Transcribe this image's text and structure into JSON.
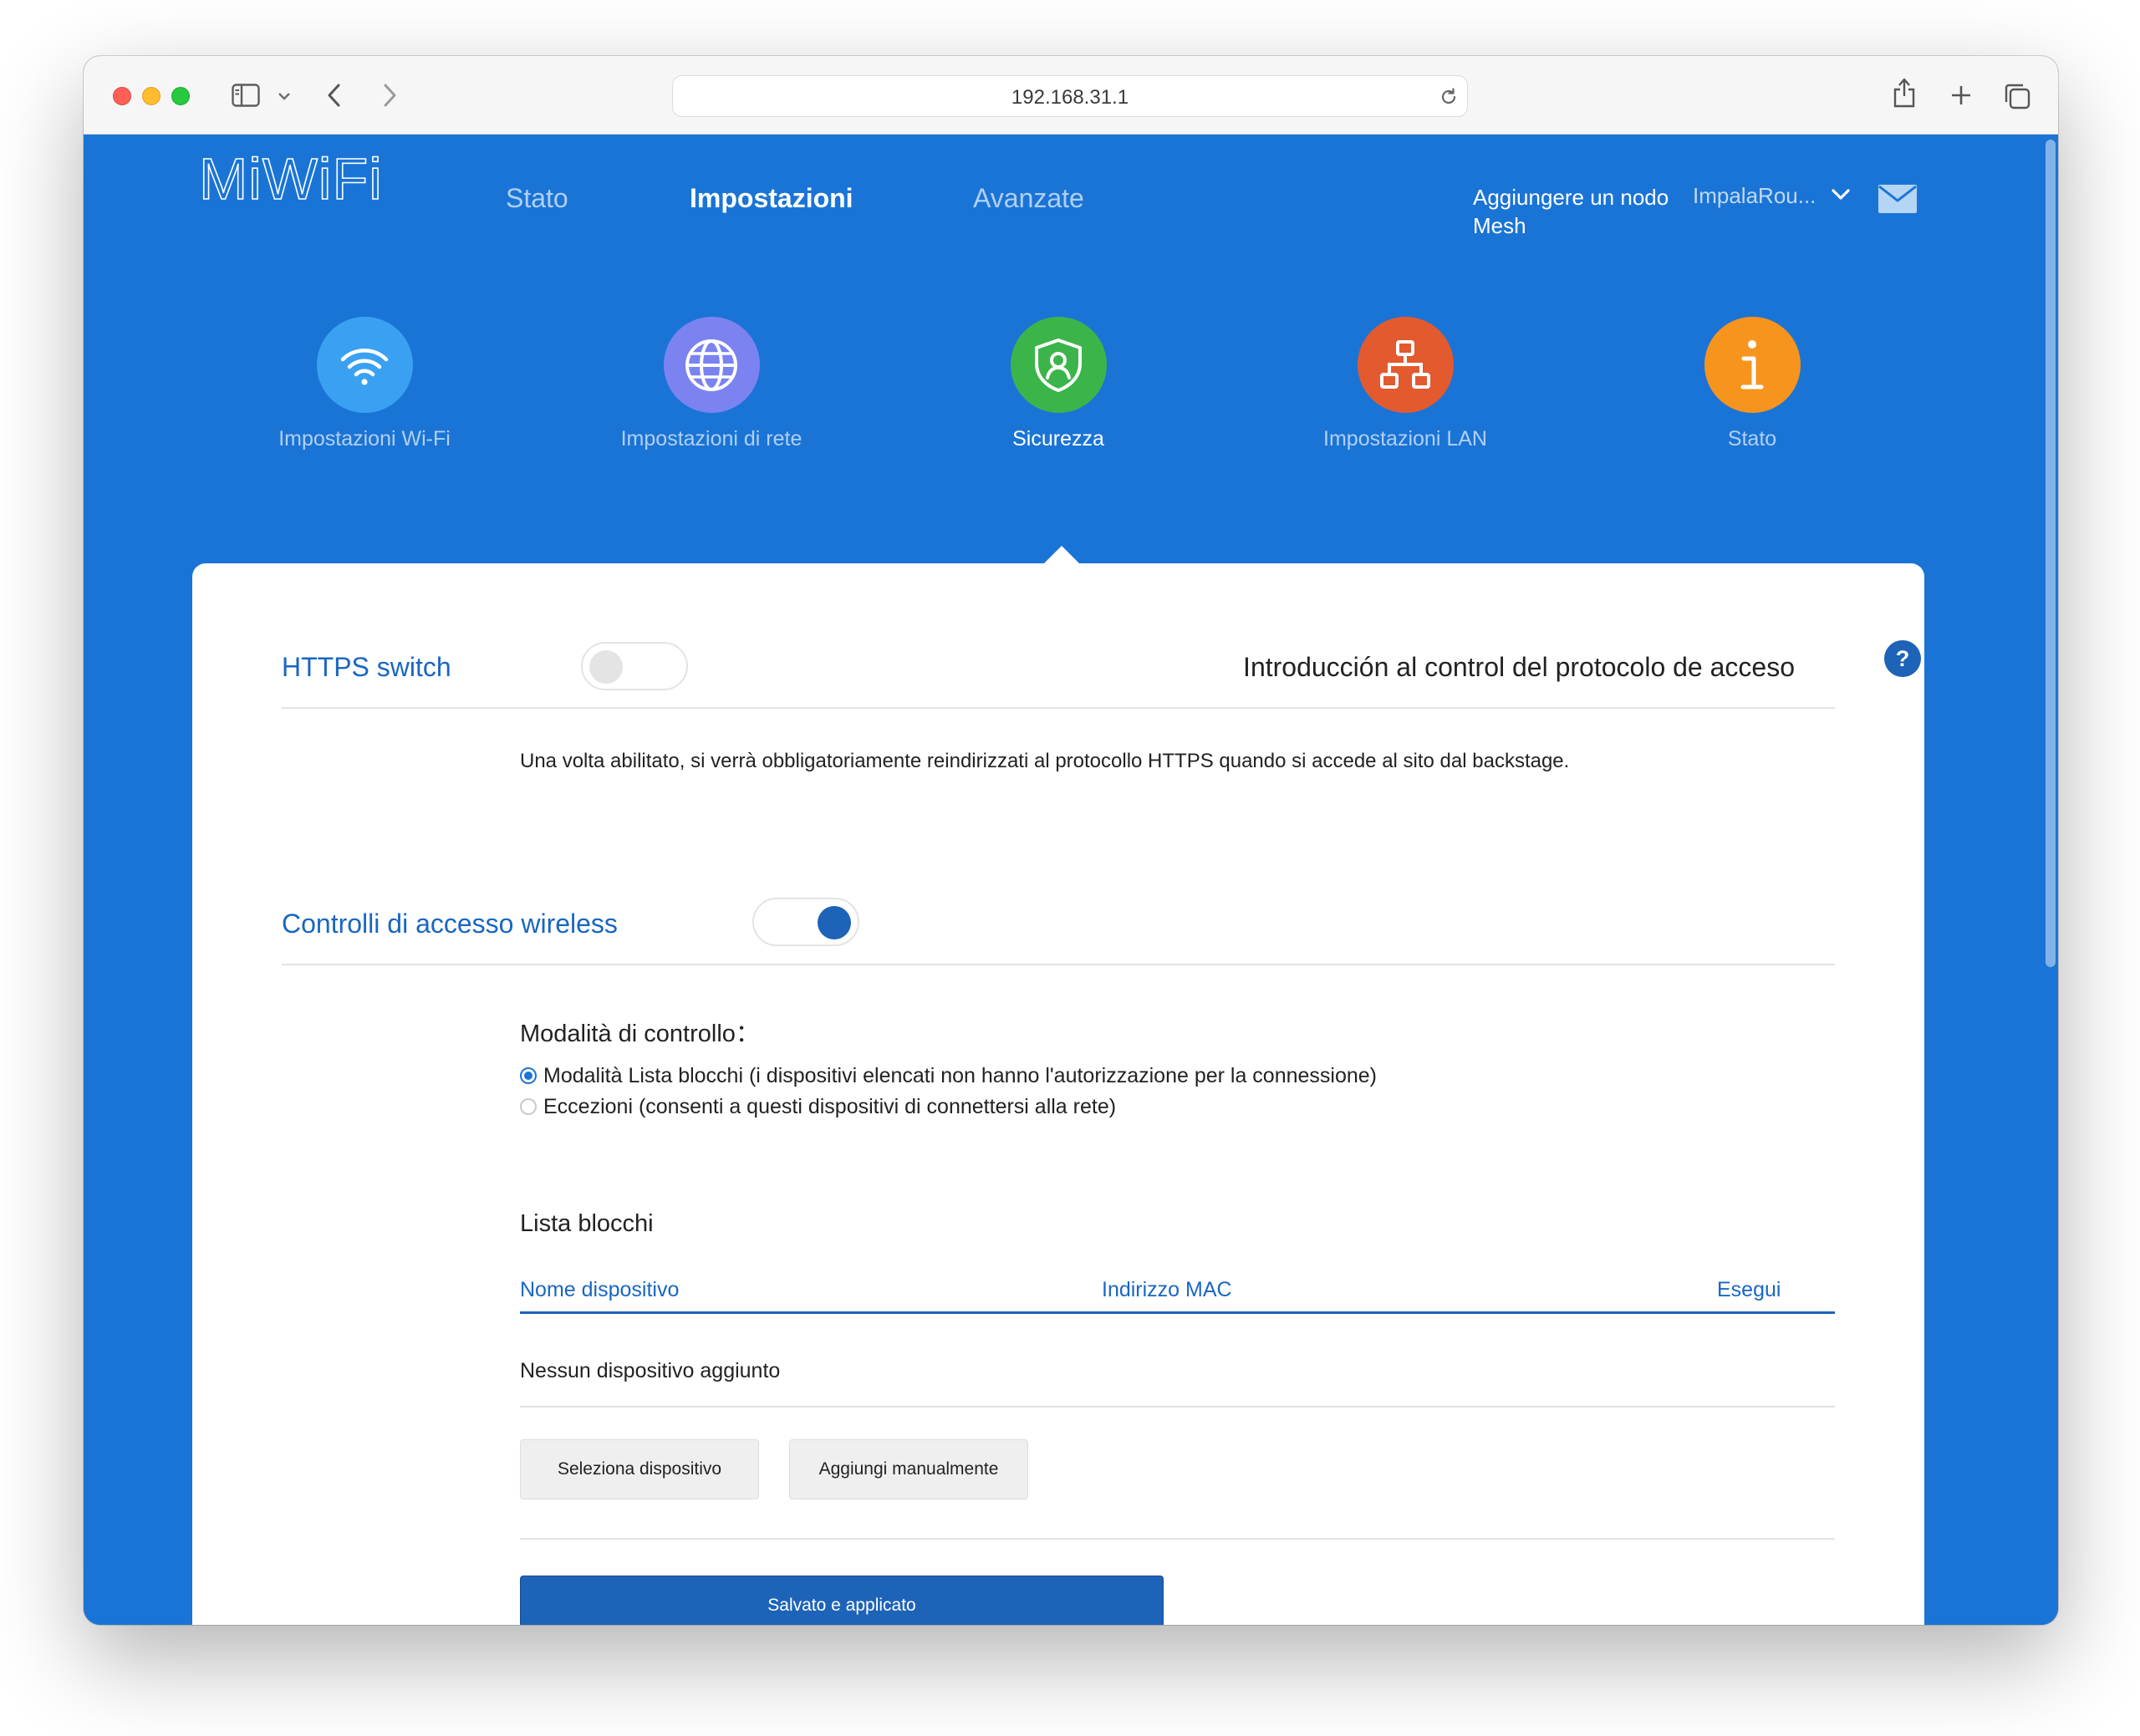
{
  "browser": {
    "url": "192.168.31.1"
  },
  "header": {
    "logo": "MiWiFi",
    "nav": [
      {
        "label": "Stato",
        "active": false
      },
      {
        "label": "Impostazioni",
        "active": true
      },
      {
        "label": "Avanzate",
        "active": false
      }
    ],
    "mesh_link": "Aggiungere un nodo Mesh",
    "router_name": "ImpalaRou..."
  },
  "categories": [
    {
      "label": "Impostazioni Wi-Fi",
      "icon": "wifi-icon",
      "color": "#3aa1f2"
    },
    {
      "label": "Impostazioni di rete",
      "icon": "globe-icon",
      "color": "#7b83f0"
    },
    {
      "label": "Sicurezza",
      "icon": "shield-user-icon",
      "color": "#3bb54a",
      "active": true
    },
    {
      "label": "Impostazioni LAN",
      "icon": "network-icon",
      "color": "#e35a2f"
    },
    {
      "label": "Stato",
      "icon": "info-icon",
      "color": "#f7941d"
    }
  ],
  "https": {
    "title": "HTTPS switch",
    "enabled": false,
    "intro_link": "Introducción al control del protocolo de acceso",
    "help_symbol": "?",
    "description": "Una volta abilitato, si verrà obbligatoriamente reindirizzati al protocollo HTTPS quando si accede al sito dal backstage."
  },
  "wireless_access": {
    "title": "Controlli di accesso wireless",
    "enabled": true,
    "mode_label": "Modalità di controllo：",
    "modes": [
      {
        "label": "Modalità Lista blocchi (i dispositivi elencati non hanno l'autorizzazione per la connessione)",
        "selected": true
      },
      {
        "label": "Eccezioni (consenti a questi dispositivi di connettersi alla rete)",
        "selected": false
      }
    ],
    "list_title": "Lista blocchi",
    "columns": [
      "Nome dispositivo",
      "Indirizzo MAC",
      "Esegui"
    ],
    "empty_text": "Nessun dispositivo aggiunto",
    "select_device_button": "Seleziona dispositivo",
    "add_manual_button": "Aggiungi manualmente",
    "save_button": "Salvato e applicato"
  },
  "colors": {
    "page_blue": "#1a74d6",
    "accent": "#1d63b8",
    "section_title": "#1a66c2"
  }
}
